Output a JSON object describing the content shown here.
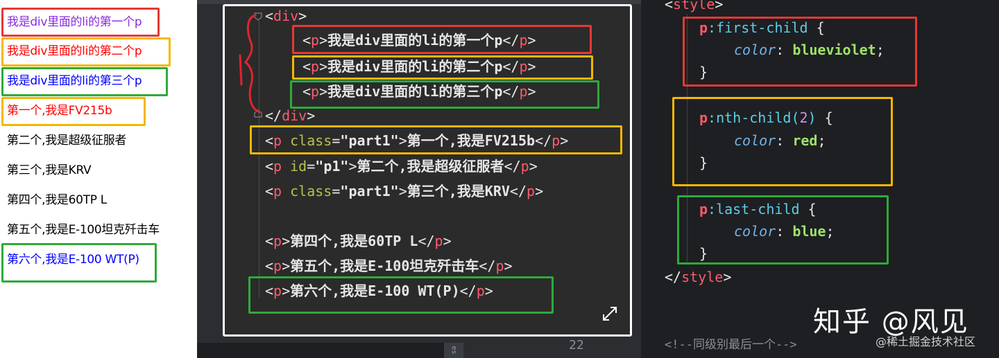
{
  "preview": {
    "lines": [
      {
        "text": "我是div里面的li的第一个p",
        "color": "#8a2be2"
      },
      {
        "text": "我是div里面的li的第二个p",
        "color": "#ff0000"
      },
      {
        "text": "我是div里面的li的第三个p",
        "color": "#0000ff"
      },
      {
        "text": "第一个,我是FV215b",
        "color": "#ff0000"
      },
      {
        "text": "第二个,我是超级征服者",
        "color": "#000000"
      },
      {
        "text": "第三个,我是KRV",
        "color": "#000000"
      },
      {
        "text": "第四个,我是60TP L",
        "color": "#000000"
      },
      {
        "text": "第五个,我是E-100坦克歼击车",
        "color": "#000000"
      },
      {
        "text": "第六个,我是E-100 WT(P)",
        "color": "#0000ff"
      }
    ]
  },
  "html_code": {
    "div_open": "div",
    "div_close": "div",
    "p": "p",
    "class_attr": "class",
    "id_attr": "id",
    "class_value": "\"part1\"",
    "id_value": "\"p1\"",
    "texts": [
      "我是div里面的li的第一个p",
      "我是div里面的li的第二个p",
      "我是div里面的li的第三个p",
      "第一个,我是FV215b",
      "第二个,我是超级征服者",
      "第三个,我是KRV",
      "第四个,我是60TP L",
      "第五个,我是E-100坦克歼击车",
      "第六个,我是E-100 WT(P)"
    ]
  },
  "css_code": {
    "style_open": "style",
    "style_close": "style",
    "rules": [
      {
        "selector": "p",
        "pseudo": ":first-child",
        "arg": "",
        "property": "color",
        "value": "blueviolet"
      },
      {
        "selector": "p",
        "pseudo": ":nth-child(",
        "arg": "2",
        "property": "color",
        "value": "red"
      },
      {
        "selector": "p",
        "pseudo": ":last-child",
        "arg": "",
        "property": "color",
        "value": "blue"
      }
    ],
    "comment": "<!--同级别最后一个-->"
  },
  "line_number": "22",
  "bottom_tab_label": "es",
  "watermark": "知乎 @风见",
  "watermark_site": "@稀土掘金技术社区",
  "colors": {
    "highlight_red": "#e53935",
    "highlight_yellow": "#f5b800",
    "highlight_green": "#2eaa3a",
    "annotation_red": "#e0242f"
  }
}
